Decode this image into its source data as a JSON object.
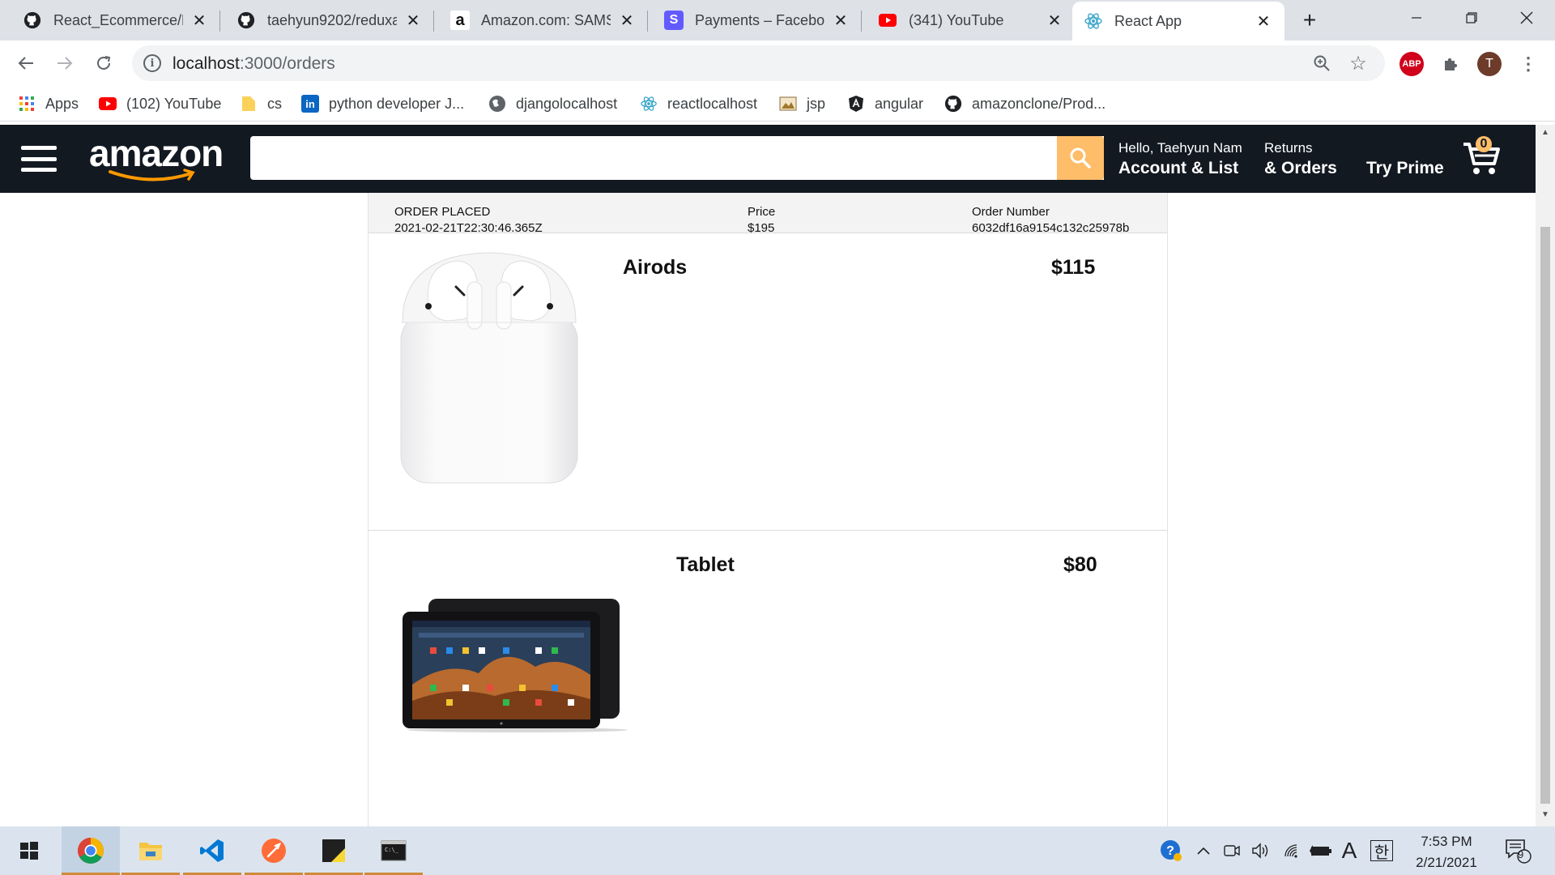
{
  "browser": {
    "tabs": [
      {
        "title": "React_Ecommerce/H",
        "icon": "github-icon"
      },
      {
        "title": "taehyun9202/reduxa",
        "icon": "github-icon"
      },
      {
        "title": "Amazon.com: SAMSU",
        "icon": "amazon-icon"
      },
      {
        "title": "Payments – Faceboo",
        "icon": "stripe-icon"
      },
      {
        "title": "(341) YouTube",
        "icon": "youtube-icon"
      },
      {
        "title": "React App",
        "icon": "react-icon"
      }
    ],
    "active_tab_index": 5,
    "url_host": "localhost",
    "url_path": ":3000/orders",
    "profile_initial": "T",
    "adblock_label": "ABP",
    "bookmarks": [
      {
        "label": "Apps",
        "icon": "apps-grid-icon"
      },
      {
        "label": "(102) YouTube",
        "icon": "youtube-icon"
      },
      {
        "label": "cs",
        "icon": "folder-icon"
      },
      {
        "label": "python developer J...",
        "icon": "linkedin-icon"
      },
      {
        "label": "djangolocalhost",
        "icon": "globe-icon"
      },
      {
        "label": "reactlocalhost",
        "icon": "react-icon"
      },
      {
        "label": "jsp",
        "icon": "image-icon"
      },
      {
        "label": "angular",
        "icon": "angular-icon"
      },
      {
        "label": "amazonclone/Prod...",
        "icon": "github-icon"
      }
    ]
  },
  "header": {
    "logo_text": "amazon",
    "search_placeholder": "",
    "greeting": "Hello, Taehyun Nam",
    "account_label": "Account & List",
    "returns_label": "Returns",
    "orders_label": "& Orders",
    "prime_label": "Try Prime",
    "cart_count": "0",
    "colors": {
      "bar": "#131921",
      "search_button": "#febd69"
    }
  },
  "order": {
    "placed_label": "ORDER PLACED",
    "placed_value": "2021-02-21T22:30:46.365Z",
    "price_label": "Price",
    "price_value": "$195",
    "number_label": "Order Number",
    "number_value": "6032df16a9154c132c25978b",
    "items": [
      {
        "name": "Airods",
        "price": "$115",
        "image": "airpods-image"
      },
      {
        "name": "Tablet",
        "price": "$80",
        "image": "tablet-image"
      }
    ]
  },
  "taskbar": {
    "apps": [
      "windows-start-icon",
      "chrome-icon",
      "file-explorer-icon",
      "vscode-icon",
      "postman-icon",
      "sticky-notes-icon",
      "terminal-icon"
    ],
    "ime_label": "A",
    "lang_label": "한",
    "time": "7:53 PM",
    "date": "2/21/2021",
    "notification_count": "9"
  }
}
